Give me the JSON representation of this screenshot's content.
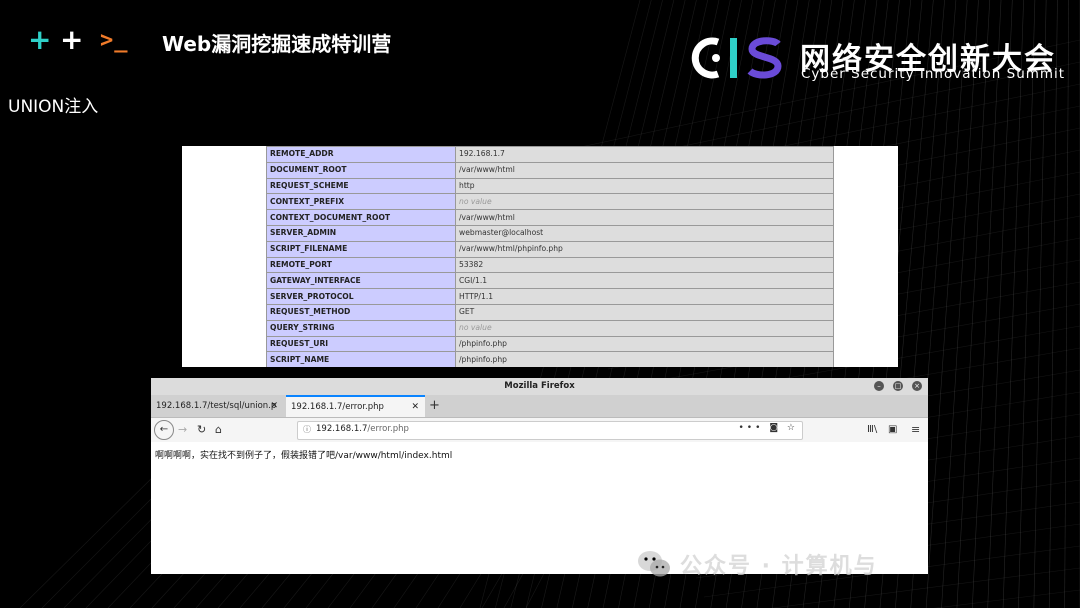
{
  "slide": {
    "course_title": "Web漏洞挖掘速成特训营",
    "prompt_symbol": ">_",
    "plus_symbol": "+",
    "section_label": "UNION注入"
  },
  "logo": {
    "mark_text": "CIS",
    "cn_name": "网络安全创新大会",
    "en_name": "Cyber Security Innovation Summit",
    "colors": {
      "c": "#ffffff",
      "i": "#2fd0c8",
      "s": "#6a4bd8"
    }
  },
  "phpinfo": {
    "rows": [
      {
        "key": "REMOTE_ADDR",
        "value": "192.168.1.7",
        "no_value": false
      },
      {
        "key": "DOCUMENT_ROOT",
        "value": "/var/www/html",
        "no_value": false
      },
      {
        "key": "REQUEST_SCHEME",
        "value": "http",
        "no_value": false
      },
      {
        "key": "CONTEXT_PREFIX",
        "value": "no value",
        "no_value": true
      },
      {
        "key": "CONTEXT_DOCUMENT_ROOT",
        "value": "/var/www/html",
        "no_value": false
      },
      {
        "key": "SERVER_ADMIN",
        "value": "webmaster@localhost",
        "no_value": false
      },
      {
        "key": "SCRIPT_FILENAME",
        "value": "/var/www/html/phpinfo.php",
        "no_value": false
      },
      {
        "key": "REMOTE_PORT",
        "value": "53382",
        "no_value": false
      },
      {
        "key": "GATEWAY_INTERFACE",
        "value": "CGI/1.1",
        "no_value": false
      },
      {
        "key": "SERVER_PROTOCOL",
        "value": "HTTP/1.1",
        "no_value": false
      },
      {
        "key": "REQUEST_METHOD",
        "value": "GET",
        "no_value": false
      },
      {
        "key": "QUERY_STRING",
        "value": "no value",
        "no_value": true
      },
      {
        "key": "REQUEST_URI",
        "value": "/phpinfo.php",
        "no_value": false
      },
      {
        "key": "SCRIPT_NAME",
        "value": "/phpinfo.php",
        "no_value": false
      }
    ]
  },
  "browser": {
    "window_title": "Mozilla Firefox",
    "tabs": [
      {
        "label": "192.168.1.7/test/sql/union.p",
        "active": false
      },
      {
        "label": "192.168.1.7/error.php",
        "active": true
      }
    ],
    "new_tab_label": "+",
    "url_host": "192.168.1.7",
    "url_path": "/error.php",
    "page_text": "啊啊啊啊，实在找不到例子了，假装报错了吧/var/www/html/index.html",
    "icons": [
      "back-icon",
      "forward-icon",
      "reload-icon",
      "home-icon",
      "info-icon",
      "more-icon",
      "pocket-icon",
      "star-icon",
      "library-icon",
      "sidebar-icon",
      "menu-icon"
    ]
  },
  "watermark": {
    "text": "公众号 · 计算机与"
  }
}
